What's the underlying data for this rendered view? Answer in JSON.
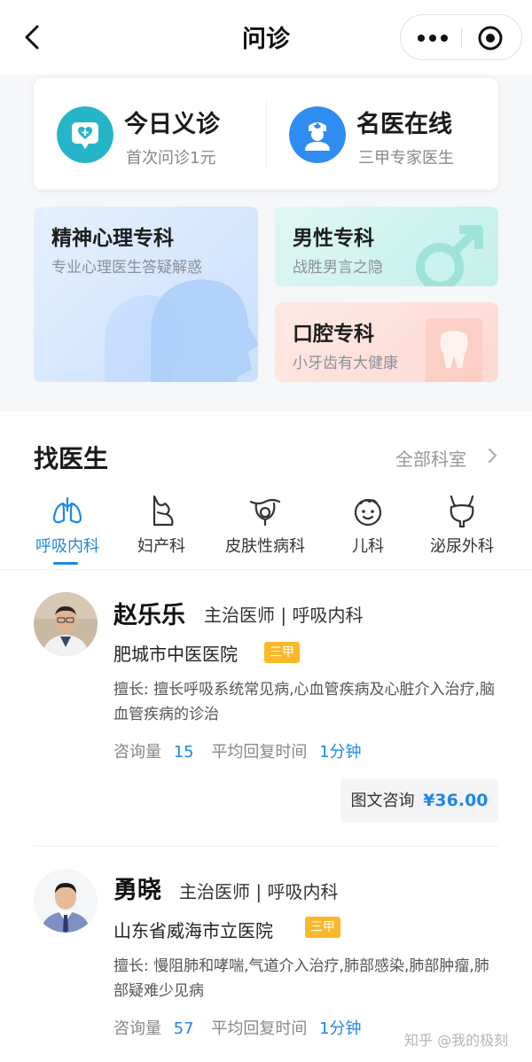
{
  "nav": {
    "title": "问诊"
  },
  "quick": {
    "left": {
      "title": "今日义诊",
      "subtitle": "首次问诊1元"
    },
    "right": {
      "title": "名医在线",
      "subtitle": "三甲专家医生"
    }
  },
  "specialties": [
    {
      "title": "精神心理专科",
      "subtitle": "专业心理医生答疑解惑"
    },
    {
      "title": "男性专科",
      "subtitle": "战胜男言之隐"
    },
    {
      "title": "口腔专科",
      "subtitle": "小牙齿有大健康"
    }
  ],
  "find": {
    "title": "找医生",
    "all_label": "全部科室",
    "categories": [
      {
        "label": "呼吸内科",
        "icon": "lungs-icon"
      },
      {
        "label": "妇产科",
        "icon": "pregnancy-icon"
      },
      {
        "label": "皮肤性病科",
        "icon": "skin-icon"
      },
      {
        "label": "儿科",
        "icon": "child-face-icon"
      },
      {
        "label": "泌尿外科",
        "icon": "bladder-icon"
      }
    ]
  },
  "doctors": [
    {
      "name": "赵乐乐",
      "role": "主治医师 | 呼吸内科",
      "hospital": "肥城市中医医院",
      "badge": "三甲",
      "skill": "擅长: 擅长呼吸系统常见病,心血管疾病及心脏介入治疗,脑血管疾病的诊治",
      "consult_label": "咨询量",
      "consult_value": "15",
      "reply_label": "平均回复时间",
      "reply_value": "1分钟",
      "button_label": "图文咨询",
      "price": "¥36.00"
    },
    {
      "name": "勇晓",
      "role": "主治医师 | 呼吸内科",
      "hospital": "山东省威海市立医院",
      "badge": "三甲",
      "skill": "擅长: 慢阻肺和哮喘,气道介入治疗,肺部感染,肺部肿瘤,肺部疑难少见病",
      "consult_label": "咨询量",
      "consult_value": "57",
      "reply_label": "平均回复时间",
      "reply_value": "1分钟"
    }
  ],
  "watermark": "知乎 @我的极刻",
  "colors": {
    "accent": "#1e88e5",
    "badge": "#fbb829",
    "teal": "#26b5c8"
  }
}
